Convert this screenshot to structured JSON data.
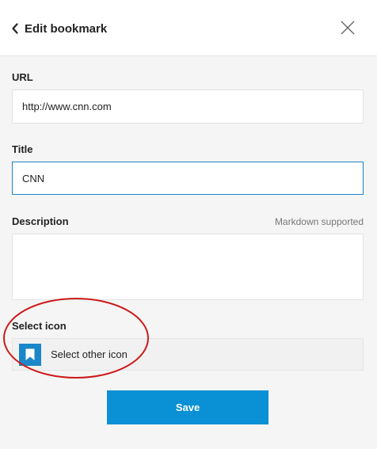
{
  "header": {
    "title": "Edit bookmark",
    "back_icon": "chevron-left-icon",
    "close_icon": "close-icon"
  },
  "form": {
    "url": {
      "label": "URL",
      "value": "http://www.cnn.com"
    },
    "title": {
      "label": "Title",
      "value": "CNN"
    },
    "description": {
      "label": "Description",
      "hint": "Markdown supported",
      "value": ""
    },
    "icon": {
      "label": "Select icon",
      "button_label": "Select other icon",
      "icon": "bookmark-icon"
    },
    "save_label": "Save"
  },
  "colors": {
    "accent": "#0990d5",
    "focus_border": "#1a82c4",
    "annotation": "#cc1a1a"
  }
}
